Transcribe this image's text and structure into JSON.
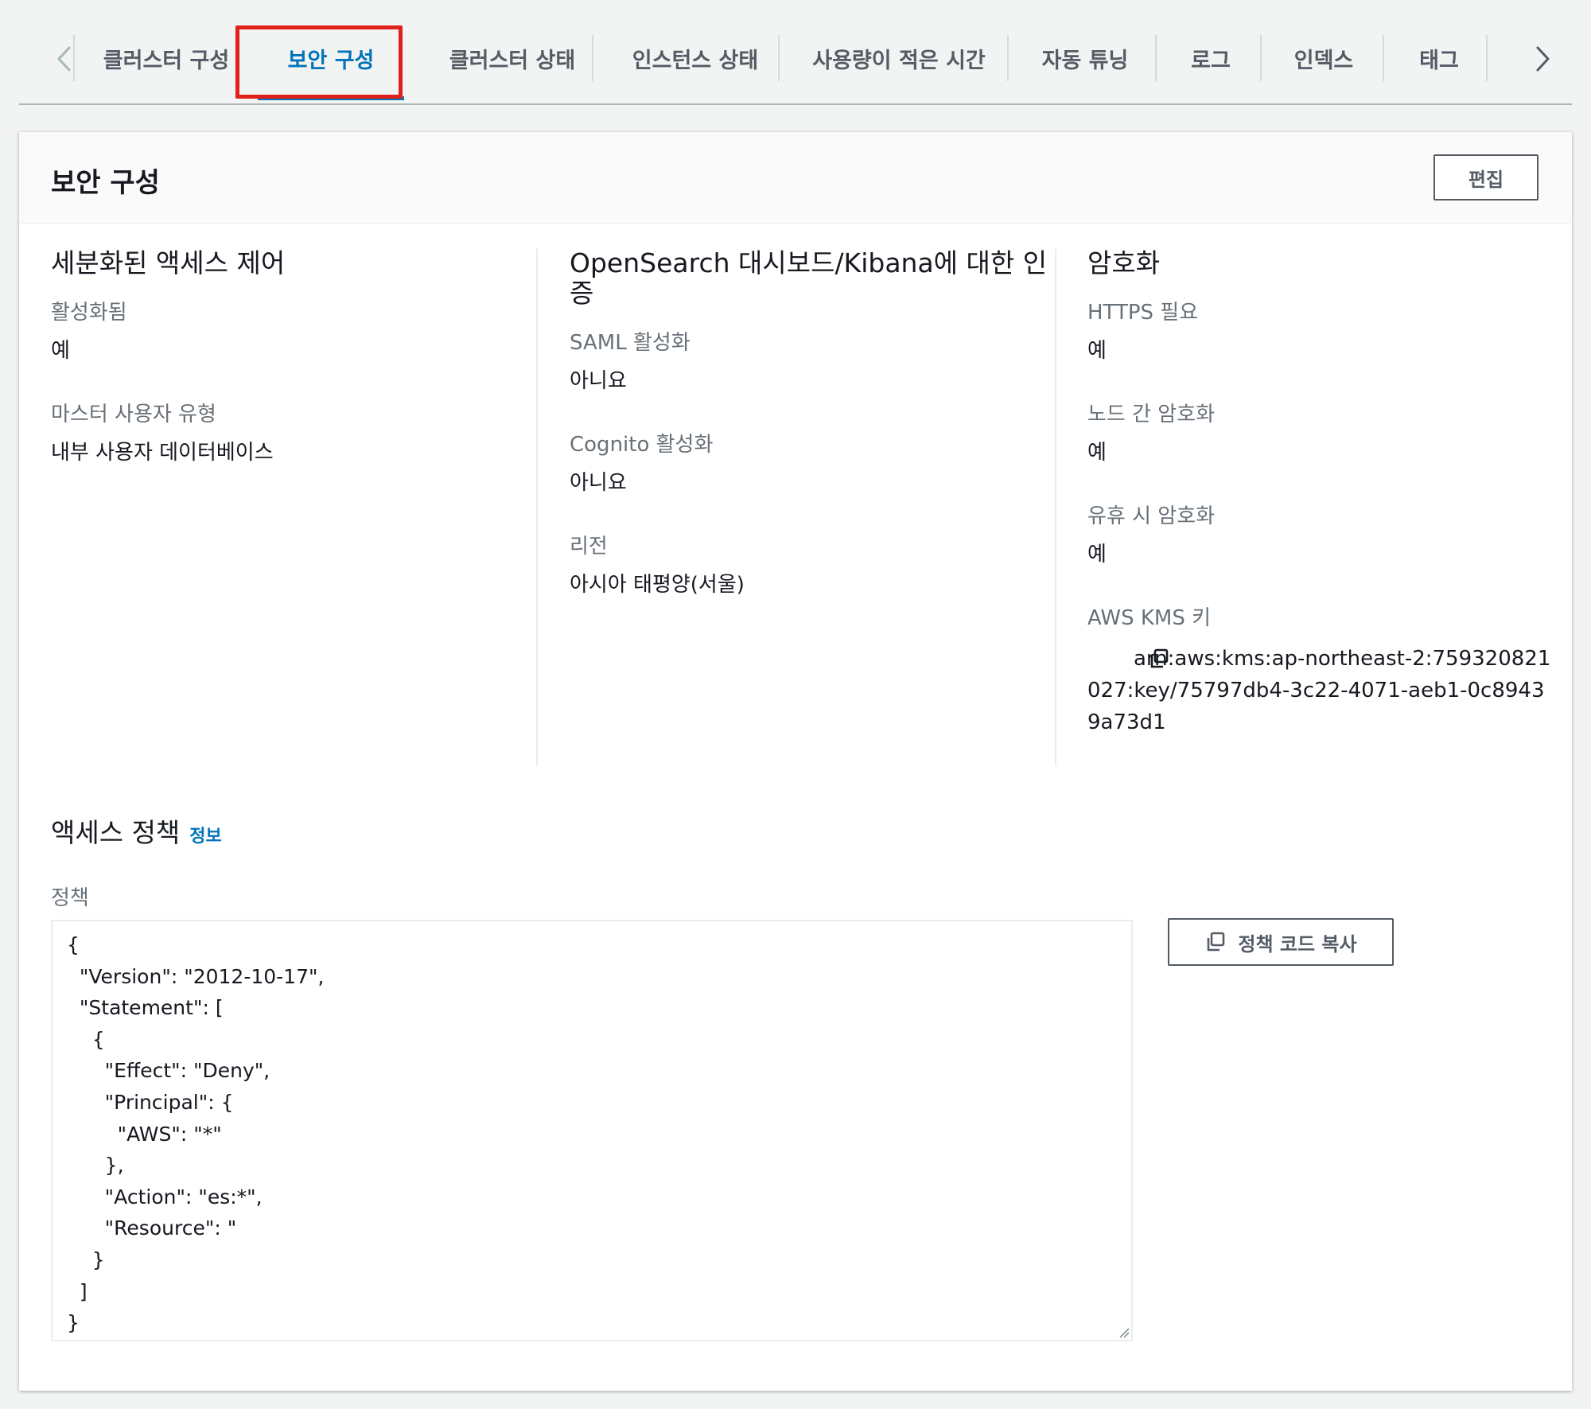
{
  "tabs": {
    "prev_icon": "chevron-left-icon",
    "next_icon": "chevron-right-icon",
    "items": [
      {
        "label": "클러스터 구성"
      },
      {
        "label": "보안 구성"
      },
      {
        "label": "클러스터 상태"
      },
      {
        "label": "인스턴스 상태"
      },
      {
        "label": "사용량이 적은 시간"
      },
      {
        "label": "자동 튜닝"
      },
      {
        "label": "로그"
      },
      {
        "label": "인덱스"
      },
      {
        "label": "태그"
      }
    ],
    "active_index": 1,
    "highlight_color": "#e0201a",
    "accent_color": "#0073bb"
  },
  "panel": {
    "title": "보안 구성",
    "edit_button": "편집"
  },
  "fgac": {
    "title": "세분화된 액세스 제어",
    "enabled_label": "활성화됨",
    "enabled_value": "예",
    "master_user_type_label": "마스터 사용자 유형",
    "master_user_type_value": "내부 사용자 데이터베이스"
  },
  "dashboards_auth": {
    "title": "OpenSearch 대시보드/Kibana에 대한 인증",
    "saml_label": "SAML 활성화",
    "saml_value": "아니요",
    "cognito_label": "Cognito 활성화",
    "cognito_value": "아니요",
    "region_label": "리전",
    "region_value": "아시아 태평양(서울)"
  },
  "encryption": {
    "title": "암호화",
    "https_label": "HTTPS 필요",
    "https_value": "예",
    "node_to_node_label": "노드 간 암호화",
    "node_to_node_value": "예",
    "at_rest_label": "유휴 시 암호화",
    "at_rest_value": "예",
    "kms_key_label": "AWS KMS 키",
    "kms_key_value": "arn:aws:kms:ap-northeast-2:759320821027:key/75797db4-3c22-4071-aeb1-0c89439a73d1",
    "copy_icon": "copy-icon"
  },
  "access_policy": {
    "title": "액세스 정책",
    "info_link": "정보",
    "policy_label": "정책",
    "policy_text": "{\n  \"Version\": \"2012-10-17\",\n  \"Statement\": [\n    {\n      \"Effect\": \"Deny\",\n      \"Principal\": {\n        \"AWS\": \"*\"\n      },\n      \"Action\": \"es:*\",\n      \"Resource\": \"\n    }\n  ]\n}",
    "copy_button": "정책 코드 복사",
    "copy_icon": "copy-icon"
  }
}
